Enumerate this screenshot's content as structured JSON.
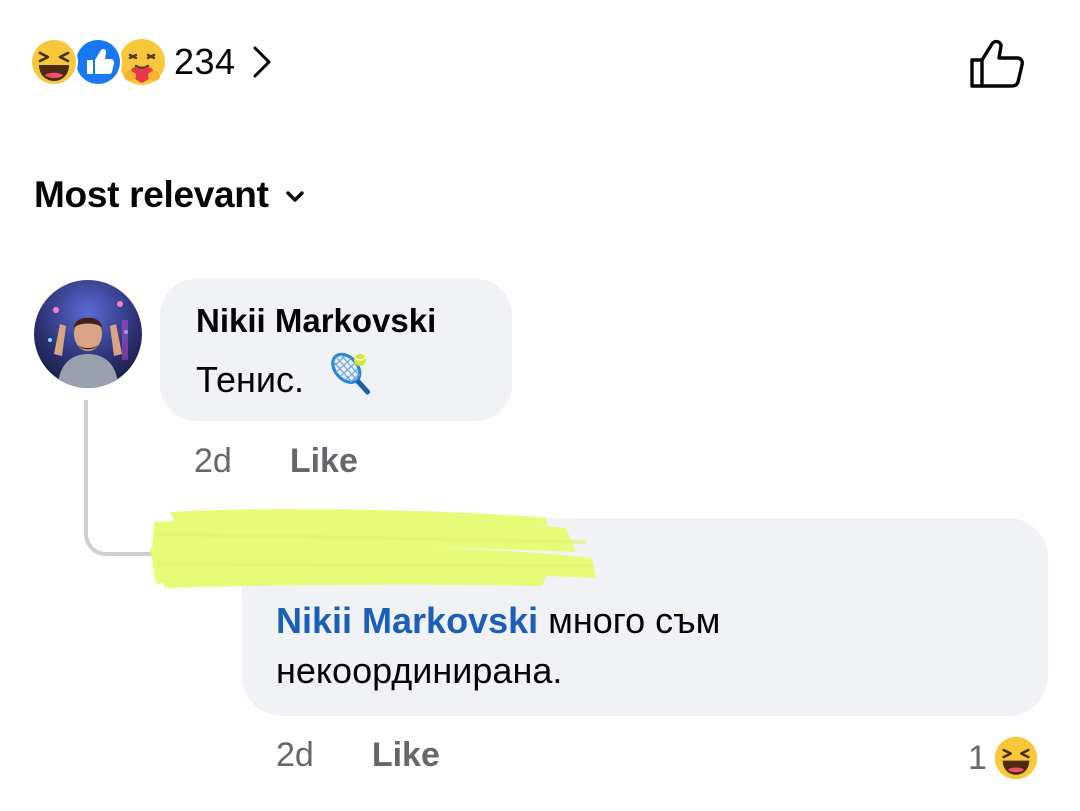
{
  "reactions": {
    "count": "234",
    "icons": [
      "laughing-emoji",
      "like-thumb",
      "care-hug-emoji"
    ]
  },
  "sort": {
    "label": "Most relevant"
  },
  "comments": [
    {
      "author": "Nikii Markovski",
      "text": "Тенис.",
      "emoji": "tennis-racket-icon",
      "time": "2d",
      "like_label": "Like"
    }
  ],
  "reply": {
    "author_redacted": true,
    "mention": "Nikii Markovski",
    "text": "много съм некоординирана.",
    "time": "2d",
    "like_label": "Like",
    "reaction_count": "1",
    "reaction_icon": "laughing-emoji"
  },
  "colors": {
    "bubble": "#f0f2f5",
    "mention": "#1b5fb8",
    "meta": "#65676b",
    "like_blue": "#1877f2",
    "emoji_yellow": "#f7c83a",
    "highlight": "#e8fb78"
  }
}
